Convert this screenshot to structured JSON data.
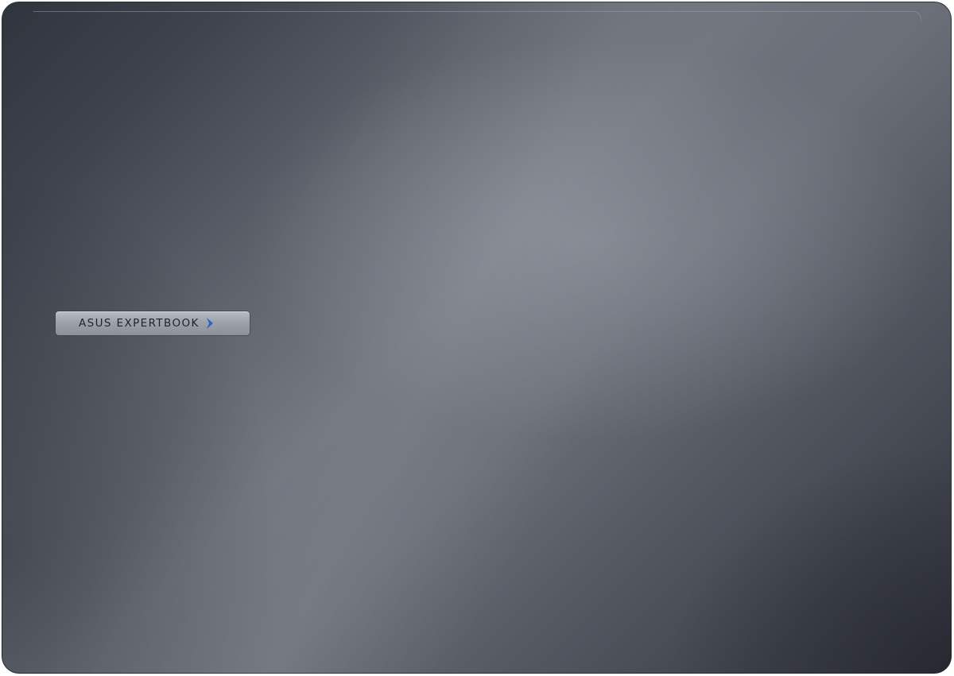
{
  "brand": {
    "badge_text": "ASUS EXPERTBOOK",
    "chevron_icon": "chevron-right-icon",
    "chevron_color": "#2f63c9"
  },
  "colors": {
    "lid_dark": "#30343d",
    "lid_light": "#6f737c",
    "badge_silver": "#a5a9b0"
  }
}
